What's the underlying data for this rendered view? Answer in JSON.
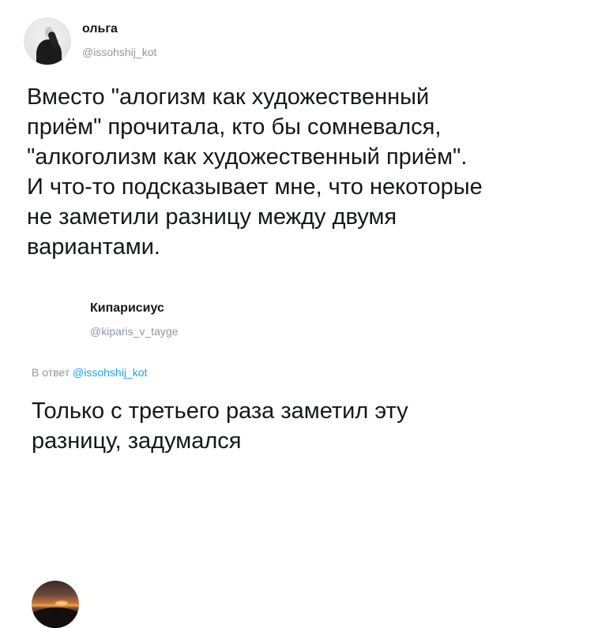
{
  "tweet": {
    "author_name": "ольга",
    "author_handle": "@issohshij_kot",
    "text": "Вместо \"алогизм как художественный\nприём\" прочитала, кто бы сомневался,\n\"алкоголизм как художественный приём\".\nИ что-то подсказывает мне, что некоторые\nне заметили разницу между двумя\nвариантами."
  },
  "reply": {
    "author_name": "Кипарисиус",
    "author_handle": "@kiparis_v_tayge",
    "reply_prefix": "В ответ",
    "reply_mention": "@issohshij_kot",
    "text": "Только с третьего раза заметил эту\nразницу, задумался"
  },
  "colors": {
    "text": "#14171a",
    "secondary": "#8b98a5",
    "link": "#1da1f2"
  },
  "icons": {
    "olga_avatar": "user-photo-avatar",
    "kiparis_avatar": "sunset-photo-avatar"
  }
}
